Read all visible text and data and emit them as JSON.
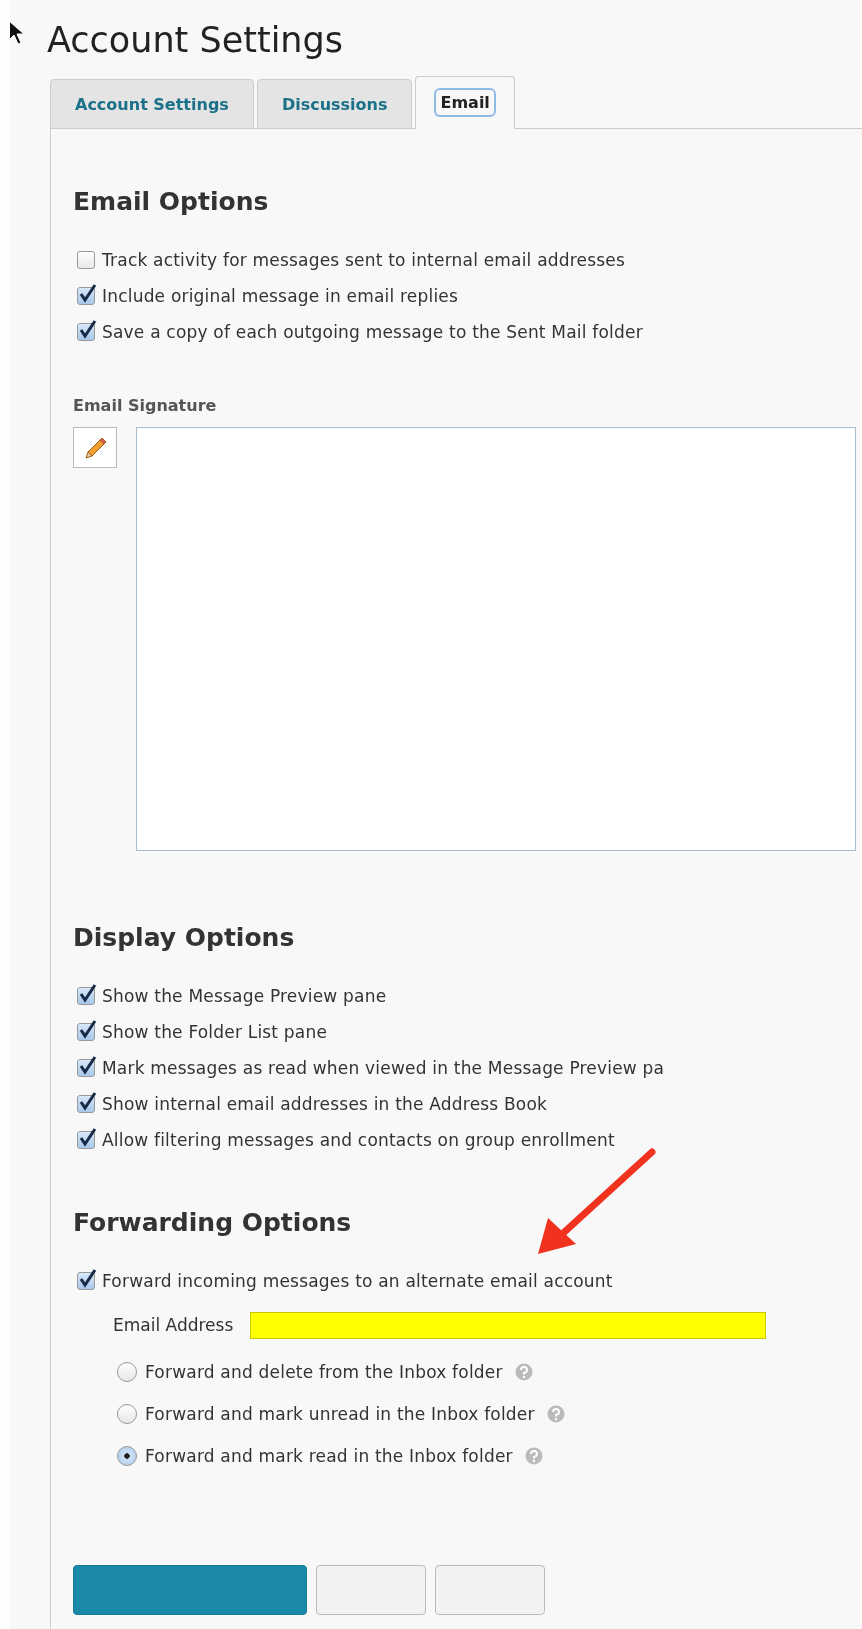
{
  "page": {
    "title": "Account Settings"
  },
  "tabs": [
    {
      "label": "Account Settings",
      "selected": false
    },
    {
      "label": "Discussions",
      "selected": false
    },
    {
      "label": "Email",
      "selected": true
    }
  ],
  "email_options": {
    "heading": "Email Options",
    "options": [
      {
        "label": "Track activity for messages sent to internal email addresses",
        "checked": false
      },
      {
        "label": "Include original message in email replies",
        "checked": true
      },
      {
        "label": "Save a copy of each outgoing message to the Sent Mail folder",
        "checked": true
      }
    ]
  },
  "email_signature": {
    "label": "Email Signature"
  },
  "display_options": {
    "heading": "Display Options",
    "options": [
      {
        "label": "Show the Message Preview pane",
        "checked": true
      },
      {
        "label": "Show the Folder List pane",
        "checked": true
      },
      {
        "label": "Mark messages as read when viewed in the Message Preview pa",
        "checked": true
      },
      {
        "label": "Show internal email addresses in the Address Book",
        "checked": true
      },
      {
        "label": "Allow filtering messages and contacts on group enrollment",
        "checked": true
      }
    ]
  },
  "forwarding_options": {
    "heading": "Forwarding Options",
    "forward": {
      "label": "Forward incoming messages to an alternate email account",
      "checked": true
    },
    "email_address": {
      "label": "Email Address",
      "highlighted": true
    },
    "modes": [
      {
        "label": "Forward and delete from the Inbox folder",
        "selected": false
      },
      {
        "label": "Forward and mark unread in the Inbox folder",
        "selected": false
      },
      {
        "label": "Forward and mark read in the Inbox folder",
        "selected": true
      }
    ]
  },
  "annotation": {
    "kind": "arrow"
  },
  "buttons": [
    {
      "kind": "primary"
    },
    {
      "kind": "secondary"
    },
    {
      "kind": "secondary"
    }
  ]
}
